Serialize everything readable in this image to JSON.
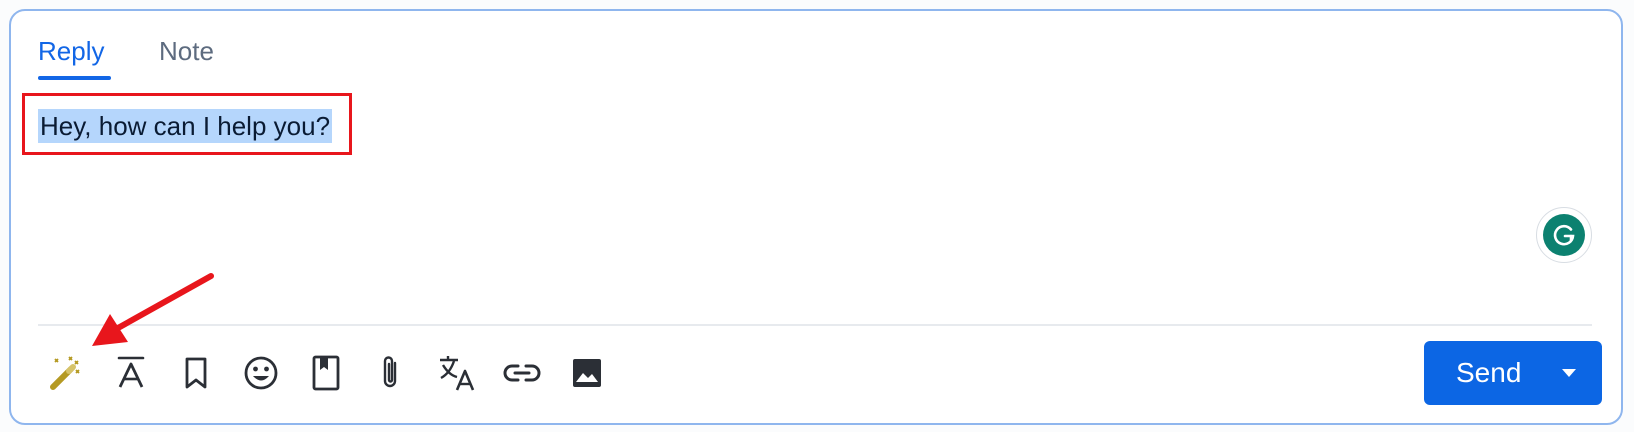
{
  "tabs": [
    {
      "label": "Reply",
      "active": true
    },
    {
      "label": "Note",
      "active": false
    }
  ],
  "message": {
    "text": "Hey, how can I help you?",
    "selected": true
  },
  "toolbar": {
    "icons": [
      {
        "name": "magic-wand-icon",
        "color": "#b59a23"
      },
      {
        "name": "text-format-icon"
      },
      {
        "name": "bookmark-icon"
      },
      {
        "name": "emoji-icon"
      },
      {
        "name": "knowledge-base-icon"
      },
      {
        "name": "attachment-icon"
      },
      {
        "name": "translate-icon"
      },
      {
        "name": "link-icon"
      },
      {
        "name": "image-icon"
      }
    ],
    "send_label": "Send"
  },
  "colors": {
    "accent": "#1266e6",
    "send_button": "#0c66e4",
    "grammarly": "#0c8170",
    "annotation": "#e8161c",
    "selection": "#b5d6fc"
  }
}
